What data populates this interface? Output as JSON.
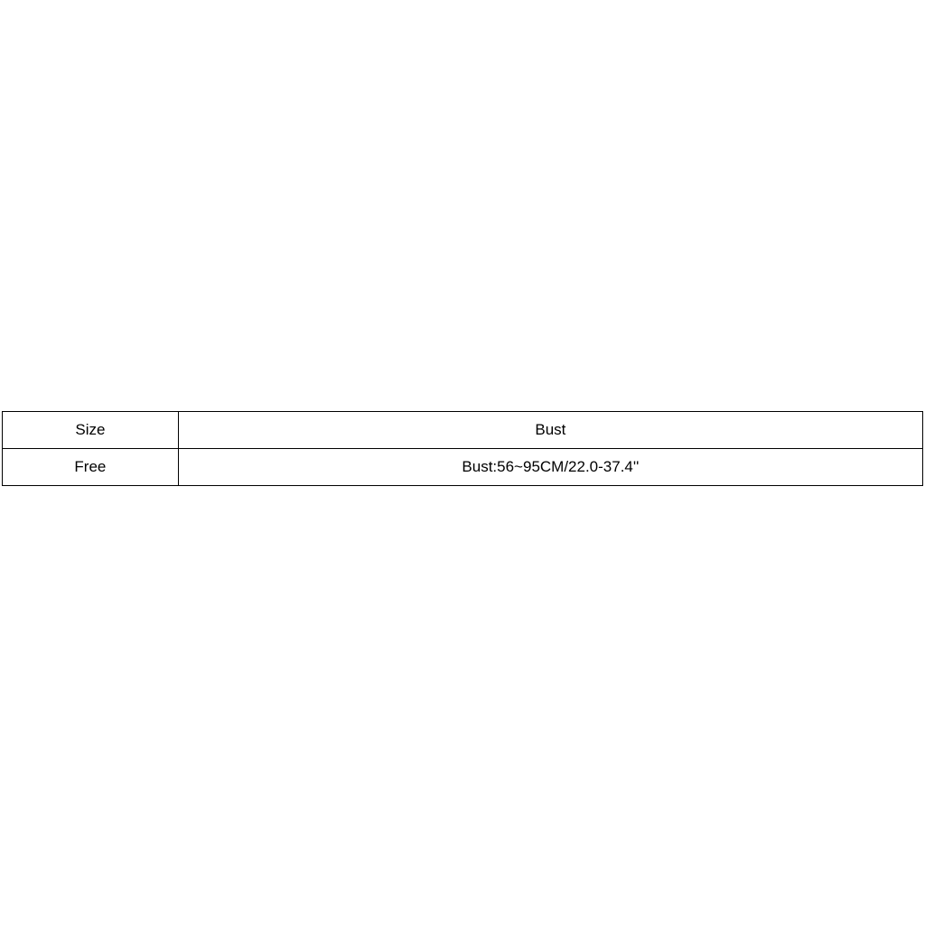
{
  "table": {
    "headers": {
      "size": "Size",
      "bust": "Bust"
    },
    "rows": [
      {
        "size": "Free",
        "bust": "Bust:56~95CM/22.0-37.4''"
      }
    ]
  }
}
